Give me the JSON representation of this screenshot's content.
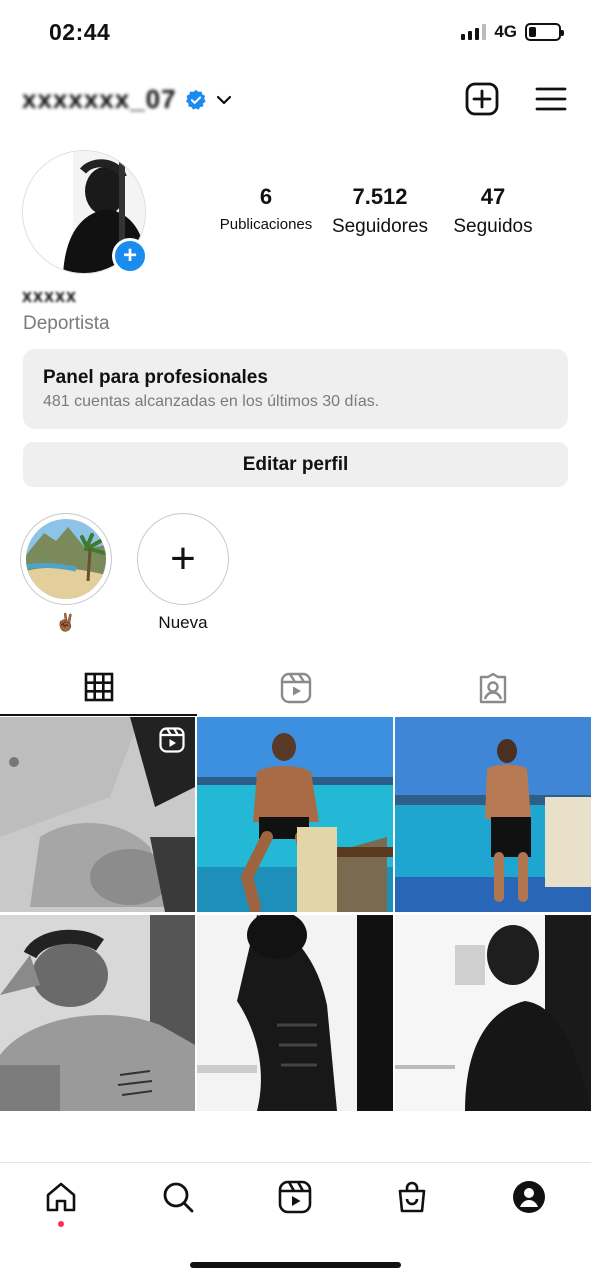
{
  "status_bar": {
    "time": "02:44",
    "network": "4G",
    "battery_level": 0.25
  },
  "header": {
    "username": "xxxxxxx_07",
    "verified_icon": "verified-badge-icon",
    "new_post_icon": "plus-square-icon",
    "menu_icon": "hamburger-menu-icon"
  },
  "profile": {
    "display_name": "xxxxx",
    "category": "Deportista",
    "stats": [
      {
        "value": "6",
        "label": "Publicaciones"
      },
      {
        "value": "7.512",
        "label": "Seguidores"
      },
      {
        "value": "47",
        "label": "Seguidos"
      }
    ],
    "add_story_label": "+"
  },
  "professional_panel": {
    "title": "Panel para profesionales",
    "subtitle": "481 cuentas alcanzadas en los últimos 30 días."
  },
  "edit_profile_label": "Editar perfil",
  "highlights": [
    {
      "label": "✌🏾"
    },
    {
      "label": "Nueva",
      "icon": "+"
    }
  ],
  "tabs": [
    {
      "icon": "grid-icon",
      "active": true
    },
    {
      "icon": "reels-icon",
      "active": false
    },
    {
      "icon": "tagged-icon",
      "active": false
    }
  ],
  "bottom_nav": [
    {
      "icon": "home-icon"
    },
    {
      "icon": "search-icon"
    },
    {
      "icon": "reels-icon"
    },
    {
      "icon": "shop-icon"
    },
    {
      "icon": "profile-icon"
    }
  ],
  "colors": {
    "accent_blue": "#1a8cf0",
    "panel_bg": "#efefef",
    "muted_text": "#7a7a7a",
    "notification_dot": "#ff2d55"
  }
}
